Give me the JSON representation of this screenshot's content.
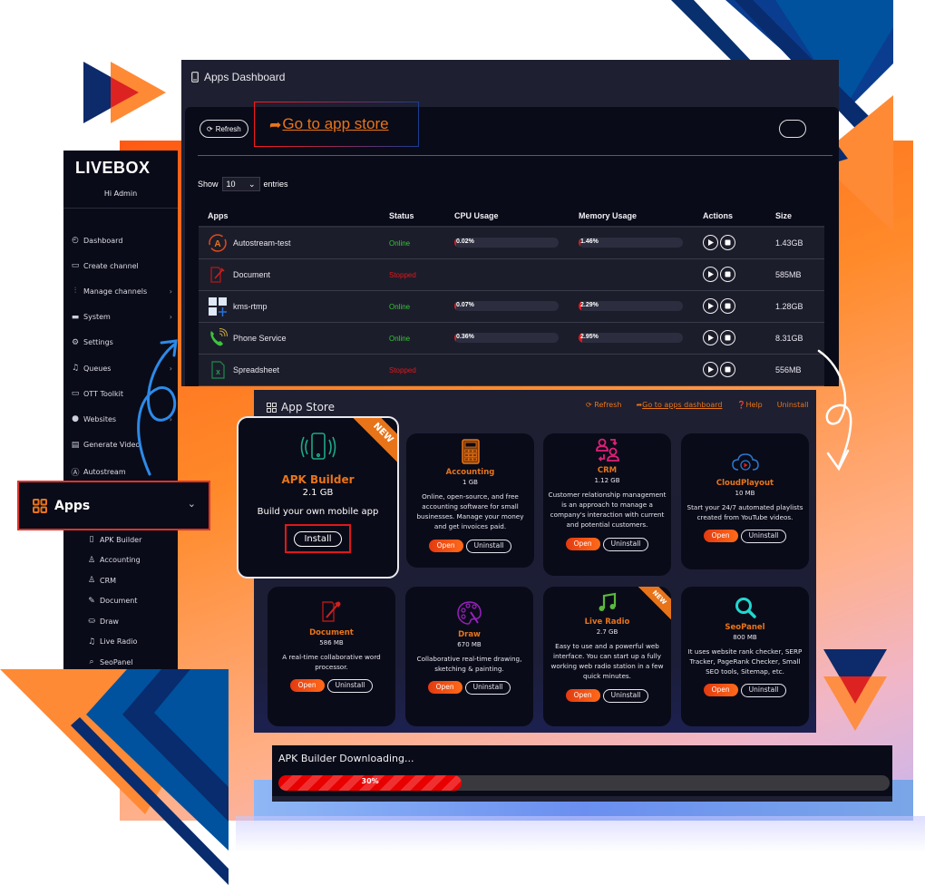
{
  "dashboard": {
    "title": "Apps Dashboard",
    "refresh_label": "Refresh",
    "go_to_store_label": "Go to app store",
    "show_label": "Show",
    "entries_value": "10",
    "entries_label": "entries",
    "columns": [
      "Apps",
      "Status",
      "CPU Usage",
      "Memory Usage",
      "Actions",
      "Size"
    ],
    "rows": [
      {
        "name": "Autostream-test",
        "icon": "autostream-icon",
        "status": "Online",
        "cpu": "0.02%",
        "cpu_value": 0.02,
        "mem": "1.46%",
        "mem_value": 1.46,
        "size": "1.43GB"
      },
      {
        "name": "Document",
        "icon": "document-icon",
        "status": "Stopped",
        "cpu": "",
        "mem": "",
        "size": "585MB"
      },
      {
        "name": "kms-rtmp",
        "icon": "kms-rtmp-icon",
        "status": "Online",
        "cpu": "0.07%",
        "cpu_value": 0.07,
        "mem": "2.29%",
        "mem_value": 2.29,
        "size": "1.28GB"
      },
      {
        "name": "Phone Service",
        "icon": "phone-icon",
        "status": "Online",
        "cpu": "0.36%",
        "cpu_value": 0.36,
        "mem": "2.95%",
        "mem_value": 2.95,
        "size": "8.31GB"
      },
      {
        "name": "Spreadsheet",
        "icon": "spreadsheet-icon",
        "status": "Stopped",
        "cpu": "",
        "mem": "",
        "size": "556MB"
      }
    ]
  },
  "sidebar": {
    "logo": "LIVEBOX",
    "greeting": "Hi Admin",
    "items": [
      {
        "label": "Dashboard",
        "icon": "gauge-icon",
        "chevron": false
      },
      {
        "label": "Create channel",
        "icon": "monitor-icon",
        "chevron": false
      },
      {
        "label": "Manage channels",
        "icon": "sliders-icon",
        "chevron": true
      },
      {
        "label": "System",
        "icon": "desktop-icon",
        "chevron": true
      },
      {
        "label": "Settings",
        "icon": "gear-icon",
        "chevron": true
      },
      {
        "label": "Queues",
        "icon": "music-icon",
        "chevron": true
      },
      {
        "label": "OTT Toolkit",
        "icon": "tv-icon",
        "chevron": false
      },
      {
        "label": "Websites",
        "icon": "globe-icon",
        "chevron": true
      },
      {
        "label": "Generate Video",
        "icon": "video-file-icon",
        "chevron": false
      },
      {
        "label": "Autostream",
        "icon": "autostream-icon",
        "chevron": false
      }
    ],
    "apps_label": "Apps",
    "sub_items": [
      {
        "label": "APK Builder",
        "icon": "phone-icon"
      },
      {
        "label": "Accounting",
        "icon": "user-icon"
      },
      {
        "label": "CRM",
        "icon": "user-icon"
      },
      {
        "label": "Document",
        "icon": "pencil-icon"
      },
      {
        "label": "Draw",
        "icon": "paint-bucket-icon"
      },
      {
        "label": "Live Radio",
        "icon": "music-icon"
      },
      {
        "label": "SeoPanel",
        "icon": "search-icon"
      }
    ]
  },
  "store": {
    "title": "App Store",
    "links": {
      "refresh": "Refresh",
      "go_dashboard": "Go to apps dashboard",
      "help": "Help",
      "uninstall": "Uninstall"
    },
    "featured": {
      "name": "APK Builder",
      "size": "2.1 GB",
      "desc": "Build your own mobile app",
      "install_label": "Install",
      "badge": "NEW"
    },
    "cards": [
      {
        "name": "Accounting",
        "size": "1 GB",
        "desc": "Online, open-source, and free accounting software for small businesses. Manage your money and get invoices paid.",
        "open": "Open",
        "uninstall": "Uninstall"
      },
      {
        "name": "CRM",
        "size": "1.12 GB",
        "desc": "Customer relationship management is an approach to manage a company's interaction with current and potential customers.",
        "open": "Open",
        "uninstall": "Uninstall"
      },
      {
        "name": "CloudPlayout",
        "size": "10 MB",
        "desc": "Start your 24/7 automated playlists created from YouTube videos.",
        "open": "Open",
        "uninstall": "Uninstall"
      },
      {
        "name": "Document",
        "size": "586 MB",
        "desc": "A real-time collaborative word processor.",
        "open": "Open",
        "uninstall": "Uninstall"
      },
      {
        "name": "Draw",
        "size": "670 MB",
        "desc": "Collaborative real-time drawing, sketching & painting.",
        "open": "Open",
        "uninstall": "Uninstall"
      },
      {
        "name": "Live Radio",
        "size": "2.7 GB",
        "desc": "Easy to use and a powerful web interface. You can start up a fully working web radio station in a few quick minutes.",
        "open": "Open",
        "uninstall": "Uninstall",
        "badge": "NEW"
      },
      {
        "name": "SeoPanel",
        "size": "800 MB",
        "desc": "It uses website rank checker, SERP Tracker, PageRank Checker, Small SEO tools, Sitemap, etc.",
        "open": "Open",
        "uninstall": "Uninstall"
      }
    ]
  },
  "download": {
    "title": "APK Builder Downloading...",
    "percent_label": "30%",
    "progress": 0.3
  },
  "colors": {
    "accent": "#e8741a",
    "online": "#34c634",
    "stopped": "#e01818",
    "navy": "#0a0b18"
  }
}
